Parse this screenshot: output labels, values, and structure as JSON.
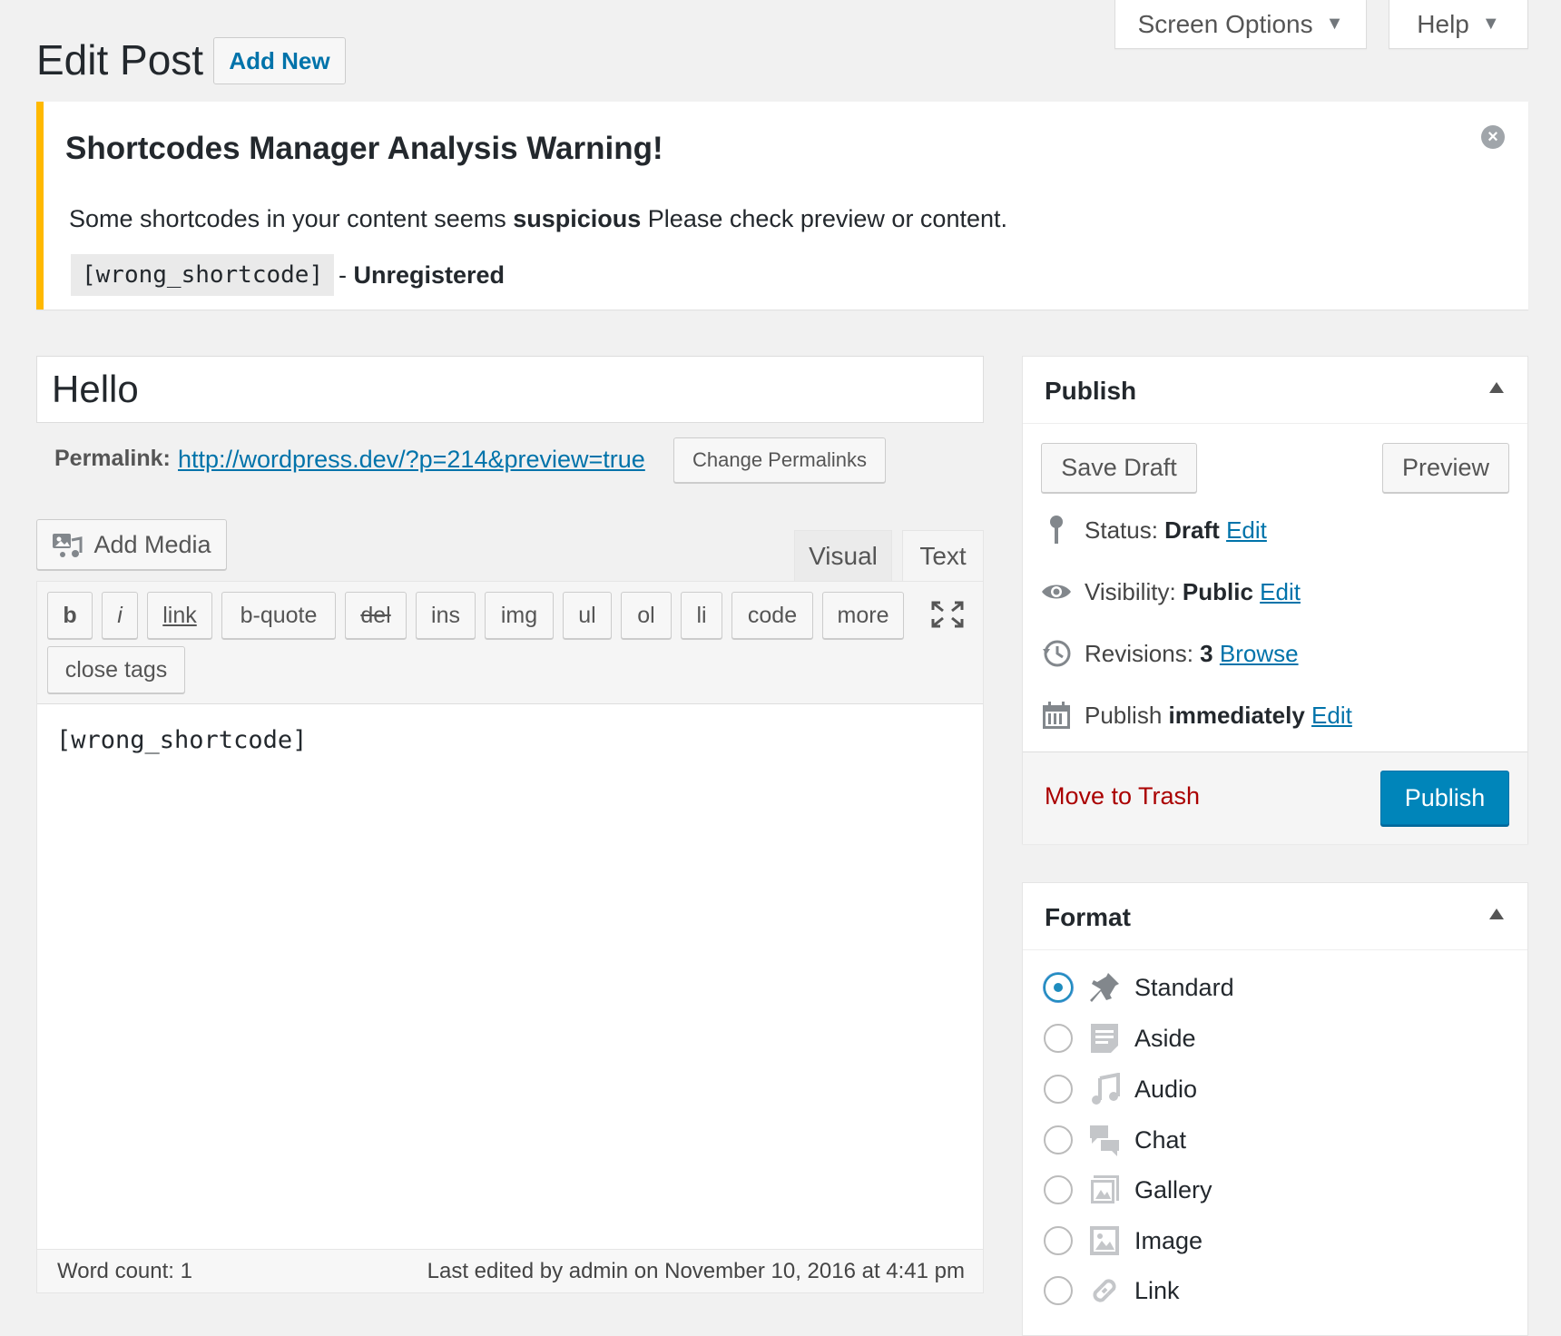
{
  "top_tabs": {
    "screen_options": "Screen Options",
    "help": "Help"
  },
  "header": {
    "title": "Edit Post",
    "add_new": "Add New"
  },
  "notice": {
    "title": "Shortcodes Manager Analysis Warning!",
    "text_before": "Some shortcodes in your content seems ",
    "text_bold": "suspicious",
    "text_after": " Please check preview or content.",
    "shortcode": "[wrong_shortcode]",
    "status_prefix": "- ",
    "status": "Unregistered"
  },
  "post": {
    "title": "Hello",
    "permalink_label": "Permalink:",
    "permalink_url": "http://wordpress.dev/?p=214&preview=true",
    "change_permalinks": "Change Permalinks"
  },
  "editor": {
    "add_media": "Add Media",
    "tabs": {
      "visual": "Visual",
      "text": "Text"
    },
    "buttons": [
      "b",
      "i",
      "link",
      "b-quote",
      "del",
      "ins",
      "img",
      "ul",
      "ol",
      "li",
      "code",
      "more",
      "close tags"
    ],
    "content": "[wrong_shortcode]",
    "word_count": "Word count: 1",
    "last_edited": "Last edited by admin on November 10, 2016 at 4:41 pm"
  },
  "publish_box": {
    "title": "Publish",
    "save_draft": "Save Draft",
    "preview": "Preview",
    "status_label": "Status: ",
    "status_value": "Draft",
    "status_edit": "Edit",
    "visibility_label": "Visibility: ",
    "visibility_value": "Public",
    "visibility_edit": "Edit",
    "revisions_label": "Revisions: ",
    "revisions_value": "3",
    "revisions_browse": "Browse",
    "publish_label": "Publish ",
    "publish_value": "immediately",
    "publish_edit": "Edit",
    "move_to_trash": "Move to Trash",
    "publish_button": "Publish",
    "primary_color": "#0085ba",
    "trash_color": "#aa0000"
  },
  "format_box": {
    "title": "Format",
    "selected": "Standard",
    "options": [
      {
        "label": "Standard",
        "icon": "pin-icon"
      },
      {
        "label": "Aside",
        "icon": "aside-icon"
      },
      {
        "label": "Audio",
        "icon": "audio-icon"
      },
      {
        "label": "Chat",
        "icon": "chat-icon"
      },
      {
        "label": "Gallery",
        "icon": "gallery-icon"
      },
      {
        "label": "Image",
        "icon": "image-icon"
      },
      {
        "label": "Link",
        "icon": "link-icon"
      }
    ]
  },
  "colors": {
    "notice_border": "#ffb900",
    "link": "#0073aa"
  }
}
